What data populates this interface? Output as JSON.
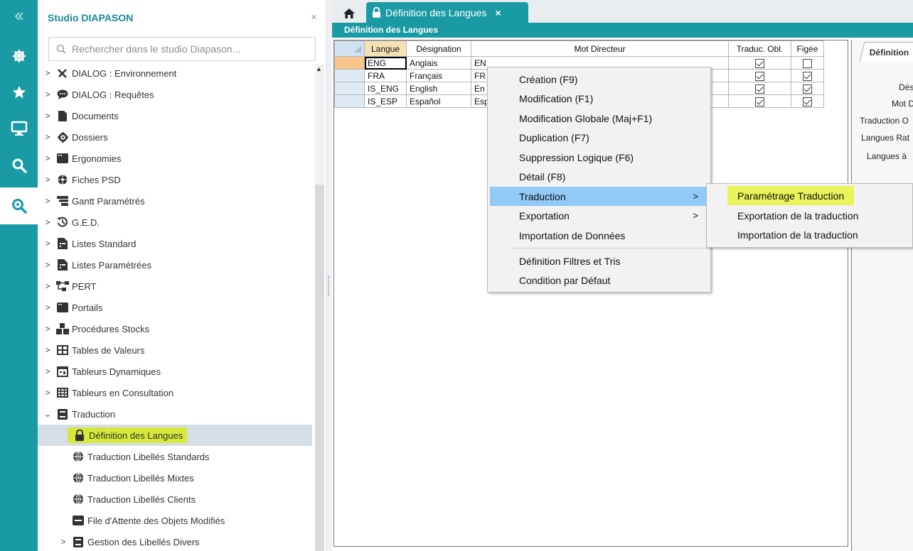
{
  "rail": {
    "items": [
      {
        "icon": "collapse-chevrons-icon"
      },
      {
        "icon": "ship-wheel-icon"
      },
      {
        "icon": "star-icon"
      },
      {
        "icon": "monitor-icon"
      },
      {
        "icon": "search-icon"
      },
      {
        "icon": "search-location-icon"
      }
    ]
  },
  "studio": {
    "title": "Studio DIAPASON",
    "close": "×",
    "search_placeholder": "Rechercher dans le studio Diapason...",
    "tree": [
      {
        "label": "DIALOG : Environnement",
        "icon": "tools-icon"
      },
      {
        "label": "DIALOG : Requêtes",
        "icon": "chat-icon"
      },
      {
        "label": "Documents",
        "icon": "document-icon"
      },
      {
        "label": "Dossiers",
        "icon": "gear-icon"
      },
      {
        "label": "Ergonomies",
        "icon": "window-icon"
      },
      {
        "label": "Fiches PSD",
        "icon": "cog-icon"
      },
      {
        "label": "Gantt Paramétrés",
        "icon": "gantt-icon"
      },
      {
        "label": "G.E.D.",
        "icon": "history-icon"
      },
      {
        "label": "Listes Standard",
        "icon": "list-file-icon"
      },
      {
        "label": "Listes Paramétrées",
        "icon": "list-file-icon"
      },
      {
        "label": "PERT",
        "icon": "network-icon"
      },
      {
        "label": "Portails",
        "icon": "window-icon"
      },
      {
        "label": "Procédures Stocks",
        "icon": "boxes-icon"
      },
      {
        "label": "Tables de Valeurs",
        "icon": "table-icon"
      },
      {
        "label": "Tableurs Dynamiques",
        "icon": "spreadsheet-icon"
      },
      {
        "label": "Tableurs en Consultation",
        "icon": "grid-icon"
      },
      {
        "label": "Traduction",
        "icon": "book-icon"
      }
    ],
    "children": [
      {
        "label": "Définition des Langues",
        "icon": "lock-icon"
      },
      {
        "label": "Traduction Libellés Standards",
        "icon": "globe-icon"
      },
      {
        "label": "Traduction Libellés Mixtes",
        "icon": "globe-icon"
      },
      {
        "label": "Traduction Libellés Clients",
        "icon": "globe-icon"
      },
      {
        "label": "File d'Attente des Objets Modifiés",
        "icon": "inbox-icon"
      },
      {
        "label": "Gestion des Libellés Divers",
        "icon": "book-icon"
      }
    ]
  },
  "tabs": {
    "active_label": "Définition des Langues",
    "close": "×"
  },
  "strip_title": "Définition des Langues",
  "grid": {
    "columns": [
      "Langue",
      "Désignation",
      "Mot Directeur",
      "Traduc. Obl.",
      "Figée"
    ],
    "rows": [
      {
        "langue": "ENG",
        "designation": "Anglais",
        "mot": "EN",
        "obl": true,
        "figee": false
      },
      {
        "langue": "FRA",
        "designation": "Français",
        "mot": "FR",
        "obl": true,
        "figee": true
      },
      {
        "langue": "IS_ENG",
        "designation": "English",
        "mot": "En",
        "obl": true,
        "figee": true
      },
      {
        "langue": "IS_ESP",
        "designation": "Español",
        "mot": "Esp",
        "obl": true,
        "figee": true
      }
    ]
  },
  "right_panel": {
    "tab": "Définition",
    "labels": [
      "Dés",
      "Mot D",
      "Traduction O",
      "Langues Rat",
      "Langues à"
    ]
  },
  "context_menu": {
    "items": [
      "Création (F9)",
      "Modification (F1)",
      "Modification Globale (Maj+F1)",
      "Duplication (F7)",
      "Suppression Logique (F6)",
      "Détail (F8)",
      "Traduction",
      "Exportation",
      "Importation de Données",
      "Définition Filtres et Tris",
      "Condition par Défaut"
    ],
    "arrow": ">"
  },
  "submenu": {
    "items": [
      "Paramétrage Traduction",
      "Exportation de la traduction",
      "Importation de la traduction"
    ]
  }
}
